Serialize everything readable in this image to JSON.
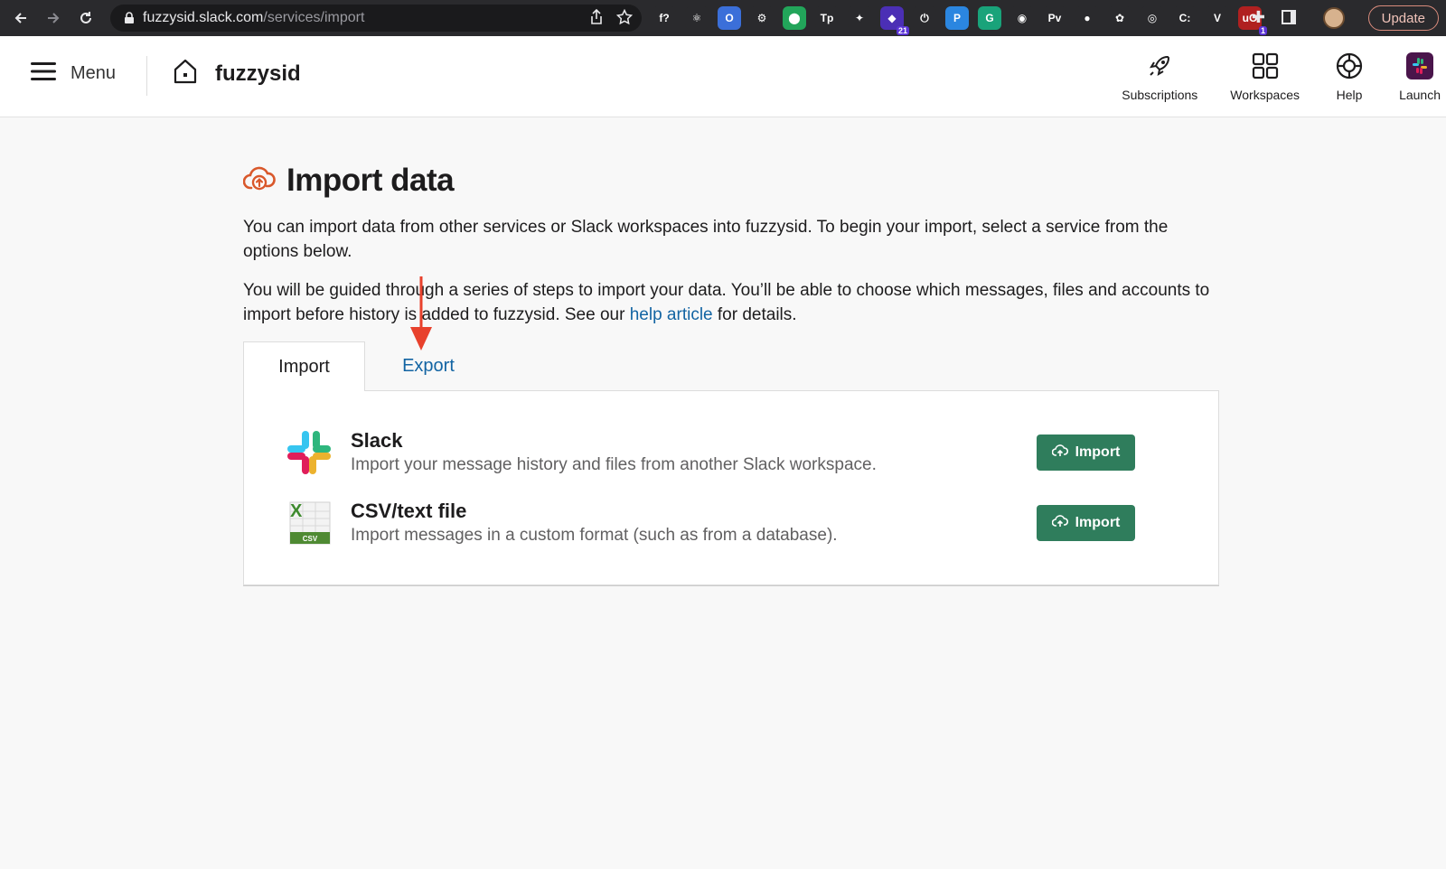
{
  "browser": {
    "url_host": "fuzzysid.slack.com",
    "url_path": "/services/import",
    "update_label": "Update",
    "extensions": [
      {
        "label": "f?",
        "color": "#2a2a2d",
        "badge": ""
      },
      {
        "label": "⚛",
        "color": "#2a2a2d",
        "badge": ""
      },
      {
        "label": "O",
        "color": "#3b6fd9",
        "badge": ""
      },
      {
        "label": "⚙",
        "color": "#2a2a2d",
        "badge": ""
      },
      {
        "label": "⬤",
        "color": "#22a55a",
        "badge": ""
      },
      {
        "label": "Tp",
        "color": "#2a2a2d",
        "badge": ""
      },
      {
        "label": "✦",
        "color": "#2a2a2d",
        "badge": ""
      },
      {
        "label": "◆",
        "color": "#4b2fb5",
        "badge": "21"
      },
      {
        "label": "⏻",
        "color": "#2a2a2d",
        "badge": ""
      },
      {
        "label": "P",
        "color": "#2b86e0",
        "badge": ""
      },
      {
        "label": "G",
        "color": "#19a37a",
        "badge": ""
      },
      {
        "label": "◉",
        "color": "#2a2a2d",
        "badge": ""
      },
      {
        "label": "Pv",
        "color": "#2a2a2d",
        "badge": ""
      },
      {
        "label": "●",
        "color": "#2a2a2d",
        "badge": ""
      },
      {
        "label": "✿",
        "color": "#2a2a2d",
        "badge": ""
      },
      {
        "label": "◎",
        "color": "#2a2a2d",
        "badge": ""
      },
      {
        "label": "C:",
        "color": "#2a2a2d",
        "badge": ""
      },
      {
        "label": "V",
        "color": "#2a2a2d",
        "badge": ""
      },
      {
        "label": "uO",
        "color": "#b02020",
        "badge": "1"
      }
    ]
  },
  "header": {
    "menu_label": "Menu",
    "workspace_name": "fuzzysid",
    "nav": [
      {
        "label": "Subscriptions",
        "icon": "rocket-icon"
      },
      {
        "label": "Workspaces",
        "icon": "grid-icon"
      },
      {
        "label": "Help",
        "icon": "lifebuoy-icon"
      },
      {
        "label": "Launch",
        "icon": "slack-logo-icon"
      }
    ]
  },
  "page": {
    "title": "Import data",
    "para1": "You can import data from other services or Slack workspaces into fuzzysid. To begin your import, select a service from the options below.",
    "para2_before": "You will be guided through a series of steps to import your data. You’ll be able to choose which messages, files and accounts to import before history is added to fuzzysid. See our ",
    "para2_link": "help article",
    "para2_after": " for details.",
    "tabs": [
      {
        "label": "Import",
        "active": true
      },
      {
        "label": "Export",
        "active": false
      }
    ],
    "services": [
      {
        "name": "Slack",
        "description": "Import your message history and files from another Slack workspace.",
        "button": "Import"
      },
      {
        "name": "CSV/text file",
        "description": "Import messages in a custom format (such as from a database).",
        "button": "Import",
        "icon_text": "CSV"
      }
    ]
  },
  "colors": {
    "accent_green": "#2f7d5c",
    "link_blue": "#1264a3",
    "annotation_red": "#e8412c",
    "title_icon": "#d9582b"
  }
}
